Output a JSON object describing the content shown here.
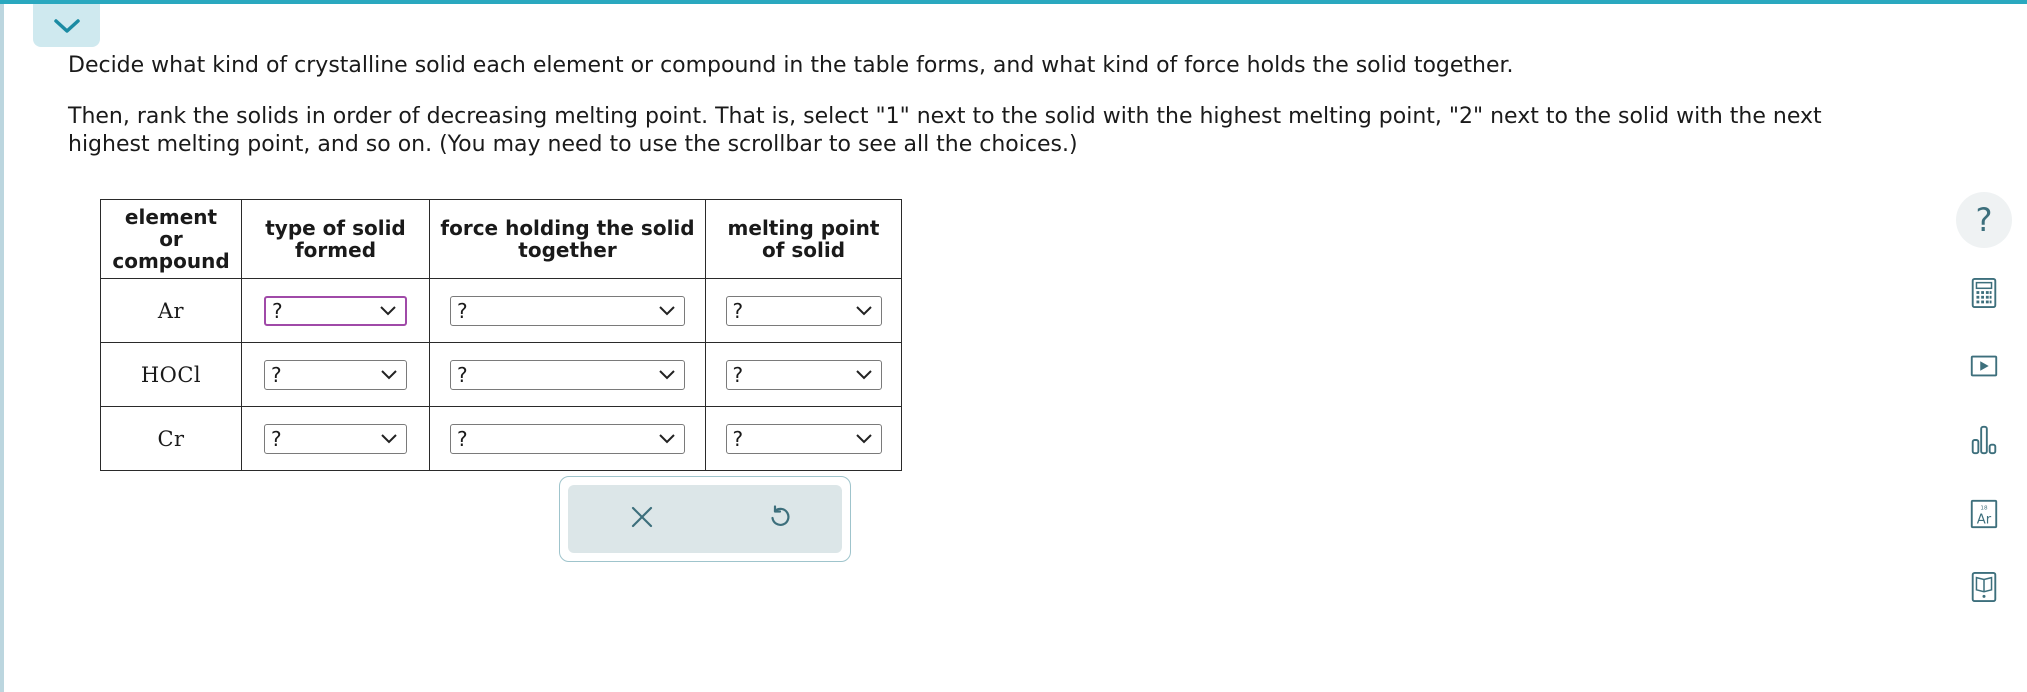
{
  "question": {
    "instruction_1": "Decide what kind of crystalline solid each element or compound in the table forms, and what kind of force holds the solid together.",
    "instruction_2": "Then, rank the solids in order of decreasing melting point. That is, select \"1\" next to the solid with the highest melting point, \"2\" next to the solid with the next highest melting point, and so on. (You may need to use the scrollbar to see all the choices.)"
  },
  "table": {
    "headers": {
      "element": [
        "element",
        "or",
        "compound"
      ],
      "type": [
        "type of solid",
        "formed"
      ],
      "force": [
        "force holding the solid",
        "together"
      ],
      "melting": [
        "melting point",
        "of solid"
      ]
    },
    "rows": [
      {
        "formula": "Ar",
        "type": "?",
        "force": "?",
        "melting": "?"
      },
      {
        "formula": "HOCl",
        "type": "?",
        "force": "?",
        "melting": "?"
      },
      {
        "formula": "Cr",
        "type": "?",
        "force": "?",
        "melting": "?"
      }
    ]
  },
  "actions": {
    "clear_icon": "close-icon",
    "undo_icon": "undo-icon"
  },
  "tools": {
    "help_glyph": "?",
    "icons": [
      "help-icon",
      "calculator-icon",
      "video-icon",
      "data-chart-icon",
      "periodic-table-icon",
      "ebook-icon"
    ],
    "periodic_tile": {
      "number": "18",
      "symbol": "Ar"
    }
  },
  "colors": {
    "accent": "#2aa8bf",
    "tool_icon": "#3d6f7c",
    "focus": "#a04aa8",
    "action_bg": "#dce6e8"
  }
}
